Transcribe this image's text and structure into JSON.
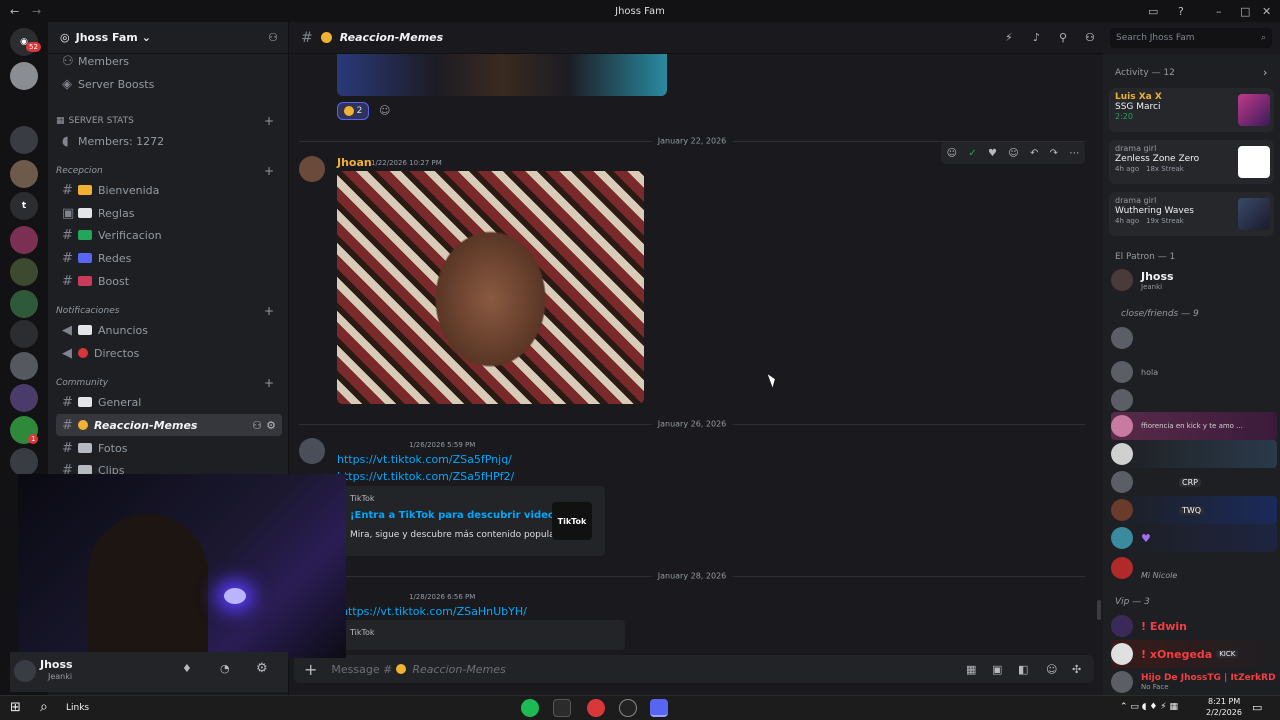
{
  "window": {
    "title": "Jhoss Fam"
  },
  "guilds": {
    "badge_top": "52",
    "badge_mid": "1",
    "letter": "t"
  },
  "sidebar": {
    "server_name": "Jhoss Fam",
    "top_items": [
      "Members",
      "Server Boosts"
    ],
    "stats_category": "SERVER STATS",
    "members_count": "Members: 1272",
    "categories": [
      {
        "name": "Recepcion",
        "channels": [
          "Bienvenida",
          "Reglas",
          "Verificacion",
          "Redes",
          "Boost"
        ]
      },
      {
        "name": "Notificaciones",
        "channels": [
          "Anuncios",
          "Directos"
        ]
      },
      {
        "name": "Community",
        "channels": [
          "General",
          "Reaccion-Memes",
          "Fotos",
          "Clips"
        ]
      }
    ],
    "sel_channel": "Reaccion-Memes"
  },
  "header": {
    "channel": "Reaccion-Memes",
    "search_placeholder": "Search Jhoss Fam"
  },
  "messages": {
    "reaction_count": "2",
    "date1": "January 22, 2026",
    "m1_author": "Jhoan",
    "m1_time": "1/22/2026 10:27 PM",
    "date2": "January 26, 2026",
    "m2_time": "1/26/2026 5:59 PM",
    "m2_link1": "https://vt.tiktok.com/ZSa5fPnjq/",
    "m2_link2": "https://vt.tiktok.com/ZSa5fHPf2/",
    "embed_provider": "TikTok",
    "embed_title": "¡Entra a TikTok para descubrir videos!",
    "embed_desc": "Mira, sigue y descubre más contenido popular.",
    "embed_thumb": "TikTok",
    "date3": "January 28, 2026",
    "m3_time": "1/28/2026 6:56 PM",
    "m3_link": "https://vt.tiktok.com/ZSaHnUbYH/",
    "embed2_provider": "TikTok"
  },
  "composer": {
    "placeholder": "Message #",
    "channel": "Reaccion-Memes"
  },
  "user": {
    "name": "Jhoss",
    "status": "Jeanki"
  },
  "activity": {
    "header": "Activity — 12",
    "cards": [
      {
        "user": "Luis Xa X",
        "game": "SSG Marci",
        "meta": "2:20"
      },
      {
        "user": "drama girl",
        "game": "Zenless Zone Zero",
        "meta": "4h ago",
        "streak": "18x Streak"
      },
      {
        "user": "drama girl",
        "game": "Wuthering Waves",
        "meta": "4h ago",
        "streak": "19x Streak"
      }
    ]
  },
  "member_list": {
    "patron_header": "El Patron — 1",
    "patron_name": "Jhoss",
    "patron_status": "Jeanki",
    "friends_header": "close/friends — 9",
    "friend_texts": [
      "hola",
      "ffiorencia en kick y te amo ...",
      "CRP",
      "TWQ",
      "Mi Nicole"
    ],
    "vip_header": "Vip — 3",
    "vip": [
      {
        "name": "! Edwin"
      },
      {
        "name": "! xOnegeda",
        "tag": "KICK"
      },
      {
        "name": "Hijo De JhossTG | ItZerkRD",
        "status": "No Face"
      }
    ]
  },
  "taskbar": {
    "search_label": "Links",
    "time": "8:21 PM",
    "date": "2/2/2026"
  },
  "colors": {
    "accent": "#5865f2",
    "link": "#00a8fc",
    "author": "#f0b232",
    "online": "#23a55a",
    "dnd": "#da373c"
  }
}
